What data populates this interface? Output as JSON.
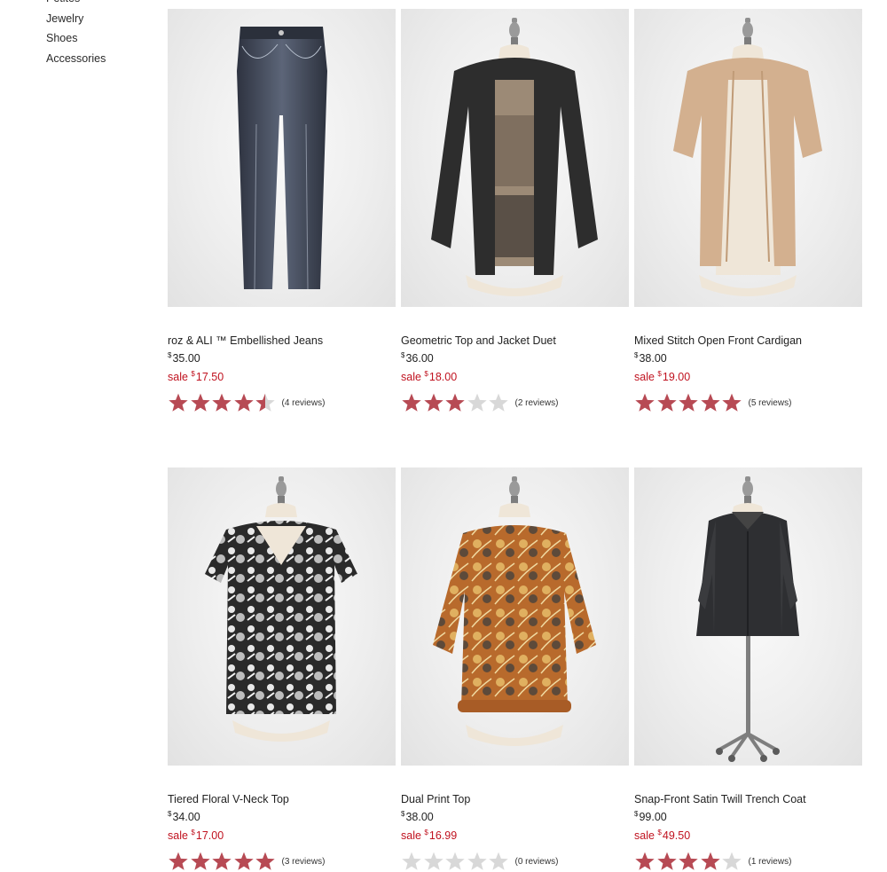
{
  "sidebar": {
    "items": [
      {
        "label": "Petites"
      },
      {
        "label": "Jewelry"
      },
      {
        "label": "Shoes"
      },
      {
        "label": "Accessories"
      }
    ]
  },
  "colors": {
    "sale_red": "#c0121f",
    "star_filled": "#b74a54",
    "star_empty": "#d8d8d8"
  },
  "products": [
    {
      "name": "roz & ALI ™ Embellished Jeans",
      "currency": "$",
      "price": "35.00",
      "sale_label": "sale",
      "sale_price": "17.50",
      "rating": 4.5,
      "reviews": "(4 reviews)",
      "image": "jeans"
    },
    {
      "name": "Geometric Top and Jacket Duet",
      "currency": "$",
      "price": "36.00",
      "sale_label": "sale",
      "sale_price": "18.00",
      "rating": 3,
      "reviews": "(2 reviews)",
      "image": "jacket-duet"
    },
    {
      "name": "Mixed Stitch Open Front Cardigan",
      "currency": "$",
      "price": "38.00",
      "sale_label": "sale",
      "sale_price": "19.00",
      "rating": 5,
      "reviews": "(5 reviews)",
      "image": "cardigan"
    },
    {
      "name": "Tiered Floral V-Neck Top",
      "currency": "$",
      "price": "34.00",
      "sale_label": "sale",
      "sale_price": "17.00",
      "rating": 5,
      "reviews": "(3 reviews)",
      "image": "floral-top"
    },
    {
      "name": "Dual Print Top",
      "currency": "$",
      "price": "38.00",
      "sale_label": "sale",
      "sale_price": "16.99",
      "rating": 0,
      "reviews": "(0 reviews)",
      "image": "paisley-top"
    },
    {
      "name": "Snap-Front Satin Twill Trench Coat",
      "currency": "$",
      "price": "99.00",
      "sale_label": "sale",
      "sale_price": "49.50",
      "rating": 4,
      "reviews": "(1 reviews)",
      "image": "trench-coat"
    }
  ]
}
